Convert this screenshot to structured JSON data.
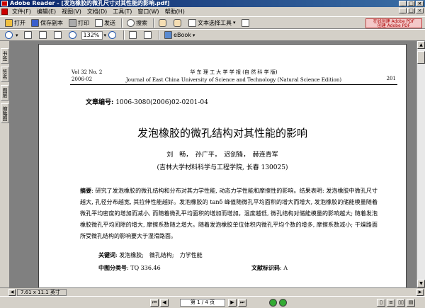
{
  "window": {
    "title": "Adobe Reader - [发泡橡胶的微孔尺寸对其性能的影响.pdf]"
  },
  "menubar": {
    "items": [
      "文件(F)",
      "编辑(E)",
      "视图(V)",
      "文档(D)",
      "工具(T)",
      "窗口(W)",
      "帮助(H)"
    ]
  },
  "toolbar1": {
    "open": "打开",
    "save_copy": "保存副本",
    "print": "打印",
    "email": "发送",
    "search": "搜索",
    "text_select": "文本选择工具",
    "create_pdf_line1": "在线创建 Adobe PDF",
    "create_pdf_line2": "创建 Adobe PDF"
  },
  "toolbar2": {
    "zoom_value": "132%",
    "ebook": "eBook"
  },
  "leftnav": {
    "tabs": [
      "书签",
      "签名",
      "图层",
      "缩略图"
    ]
  },
  "document": {
    "header_left_line1": "Vol 32 No. 2",
    "header_left_line2": "2006-02",
    "header_center_line1": "华 东 理 工 大 学 学 报 (自 然 科 学 版)",
    "header_center_line2": "Journal of East China University of Science and Technology (Natural Science Edition)",
    "header_right": "201",
    "article_no_label": "文章编号:",
    "article_no_value": " 1006-3080(2006)02-0201-04",
    "title": "发泡橡胶的微孔结构对其性能的影响",
    "authors": "刘　畅，　孙广平，　迟剑锋，　赫连青军",
    "affiliation": "(吉林大学材料科学与工程学院, 长春 130025)",
    "abstract_label": "摘要",
    "abstract_text": ": 研究了发泡橡胶的微孔结构和分布对其力学性能, 动态力学性能和摩擦性的影响。结果表明: 发泡橡胶中微孔尺寸越大, 孔径分布越宽, 其拉伸性能越好。发泡橡胶的 tanδ 峰值随微孔平均面积的增大而增大, 发泡橡胶的储能模量随着微孔平均密度的增加而减小, 而随着微孔平均面积的增加而增加。温度越低, 微孔结构对储能模量的影响越大; 随着发泡橡胶微孔平均间隙的增大, 摩擦系数随之增大。随着发泡橡胶单位体积内微孔平均个数的增多, 摩擦系数减小; 干燥路面所受微孔结构的影响要大于湿滑路面。",
    "keywords_label": "关键词",
    "keywords_text": ": 发泡橡胶;　微孔结构;　力学性能",
    "classno_label": "中图分类号",
    "classno_text": ": TQ 336.46",
    "docid_label": "文献标识码",
    "docid_text": ": A"
  },
  "status": {
    "page_size": "7.61 x 11.1 英寸",
    "page_indicator": "第 1 / 4 页"
  }
}
